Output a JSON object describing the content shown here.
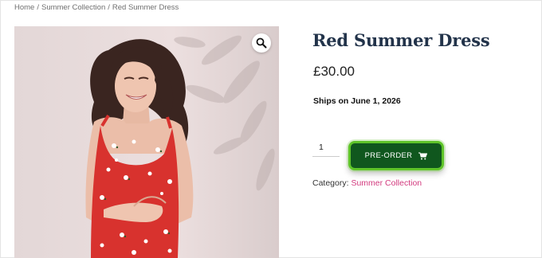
{
  "breadcrumb": {
    "items": [
      "Home",
      "Summer Collection",
      "Red Summer Dress"
    ],
    "separator": "/"
  },
  "product": {
    "title": "Red Summer Dress",
    "price": "£30.00",
    "shipping_note": "Ships on June 1, 2026",
    "quantity": "1",
    "preorder_label": "PRE-ORDER",
    "category_label": "Category:",
    "category_link": "Summer Collection"
  },
  "icons": {
    "zoom": "magnifier-icon",
    "cart": "cart-icon"
  },
  "colors": {
    "button_bg": "#10571e",
    "button_border": "#5fc429",
    "link": "#d23a7e",
    "title": "#22334a",
    "dress": "#d8322e"
  }
}
